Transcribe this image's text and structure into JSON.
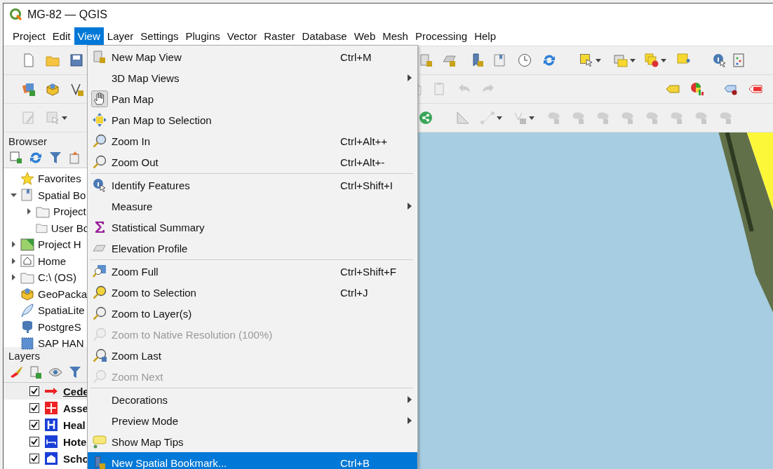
{
  "window": {
    "title": "MG-82 — QGIS"
  },
  "menubar": [
    {
      "label": "Project",
      "selected": false
    },
    {
      "label": "Edit",
      "selected": false
    },
    {
      "label": "View",
      "selected": true
    },
    {
      "label": "Layer",
      "selected": false
    },
    {
      "label": "Settings",
      "selected": false
    },
    {
      "label": "Plugins",
      "selected": false
    },
    {
      "label": "Vector",
      "selected": false
    },
    {
      "label": "Raster",
      "selected": false
    },
    {
      "label": "Database",
      "selected": false
    },
    {
      "label": "Web",
      "selected": false
    },
    {
      "label": "Mesh",
      "selected": false
    },
    {
      "label": "Processing",
      "selected": false
    },
    {
      "label": "Help",
      "selected": false
    }
  ],
  "view_menu": {
    "groups": [
      [
        {
          "label": "New Map View",
          "shortcut": "Ctrl+M",
          "kind": "mapview",
          "submenu": false,
          "disabled": false,
          "selected": false
        },
        {
          "label": "3D Map Views",
          "kind": "none",
          "submenu": true,
          "disabled": false,
          "selected": false
        },
        {
          "label": "Pan Map",
          "kind": "pan",
          "submenu": false,
          "disabled": false,
          "selected": false,
          "checked": true
        },
        {
          "label": "Pan Map to Selection",
          "kind": "panselect",
          "submenu": false,
          "disabled": false,
          "selected": false
        },
        {
          "label": "Zoom In",
          "shortcut": "Ctrl+Alt++",
          "kind": "zoomin",
          "submenu": false,
          "disabled": false,
          "selected": false
        },
        {
          "label": "Zoom Out",
          "shortcut": "Ctrl+Alt+-",
          "kind": "zoomout",
          "submenu": false,
          "disabled": false,
          "selected": false
        }
      ],
      [
        {
          "label": "Identify Features",
          "shortcut": "Ctrl+Shift+I",
          "kind": "identify",
          "submenu": false,
          "disabled": false,
          "selected": false
        },
        {
          "label": "Measure",
          "kind": "none",
          "submenu": true,
          "disabled": false,
          "selected": false
        },
        {
          "label": "Statistical Summary",
          "kind": "sigma",
          "submenu": false,
          "disabled": false,
          "selected": false
        },
        {
          "label": "Elevation Profile",
          "kind": "profile",
          "submenu": false,
          "disabled": false,
          "selected": false
        }
      ],
      [
        {
          "label": "Zoom Full",
          "shortcut": "Ctrl+Shift+F",
          "kind": "zoomfull",
          "submenu": false,
          "disabled": false,
          "selected": false
        },
        {
          "label": "Zoom to Selection",
          "shortcut": "Ctrl+J",
          "kind": "zoomsel",
          "submenu": false,
          "disabled": false,
          "selected": false
        },
        {
          "label": "Zoom to Layer(s)",
          "kind": "zoomlayer",
          "submenu": false,
          "disabled": false,
          "selected": false
        },
        {
          "label": "Zoom to Native Resolution (100%)",
          "kind": "zoomnative",
          "submenu": false,
          "disabled": true,
          "selected": false
        },
        {
          "label": "Zoom Last",
          "kind": "zoomlast",
          "submenu": false,
          "disabled": false,
          "selected": false
        },
        {
          "label": "Zoom Next",
          "kind": "zoomnext",
          "submenu": false,
          "disabled": true,
          "selected": false
        }
      ],
      [
        {
          "label": "Decorations",
          "kind": "none",
          "submenu": true,
          "disabled": false,
          "selected": false
        },
        {
          "label": "Preview Mode",
          "kind": "none",
          "submenu": true,
          "disabled": false,
          "selected": false
        },
        {
          "label": "Show Map Tips",
          "kind": "tips",
          "submenu": false,
          "disabled": false,
          "selected": false
        },
        {
          "label": "New Spatial Bookmark...",
          "shortcut": "Ctrl+B",
          "kind": "bookmark",
          "submenu": false,
          "disabled": false,
          "selected": true
        }
      ]
    ]
  },
  "browser": {
    "title": "Browser",
    "items": [
      {
        "label": "Favorites",
        "kind": "star"
      },
      {
        "label": "Spatial Bo",
        "kind": "bookmarks",
        "expanded": true,
        "children": [
          {
            "label": "Project",
            "kind": "folder",
            "expanded": false
          },
          {
            "label": "User Bo",
            "kind": "folder"
          }
        ]
      },
      {
        "label": "Project H",
        "kind": "map",
        "expanded": false
      },
      {
        "label": "Home",
        "kind": "home",
        "expanded": false
      },
      {
        "label": "C:\\ (OS)",
        "kind": "folder",
        "expanded": false
      },
      {
        "label": "GeoPacka",
        "kind": "cube"
      },
      {
        "label": "SpatiaLite",
        "kind": "feather"
      },
      {
        "label": "PostgreS",
        "kind": "database"
      },
      {
        "label": "SAP HAN",
        "kind": "dashed"
      }
    ]
  },
  "layers": {
    "title": "Layers",
    "items": [
      {
        "label": "Cede",
        "kind": "arrow",
        "checked": true,
        "selected": true
      },
      {
        "label": "Asse",
        "kind": "plus",
        "checked": true,
        "selected": false
      },
      {
        "label": "Heal",
        "kind": "health",
        "checked": true,
        "selected": false
      },
      {
        "label": "Hote",
        "kind": "bed",
        "checked": true,
        "selected": false
      },
      {
        "label": "Scho",
        "kind": "school",
        "checked": true,
        "selected": false
      }
    ]
  }
}
